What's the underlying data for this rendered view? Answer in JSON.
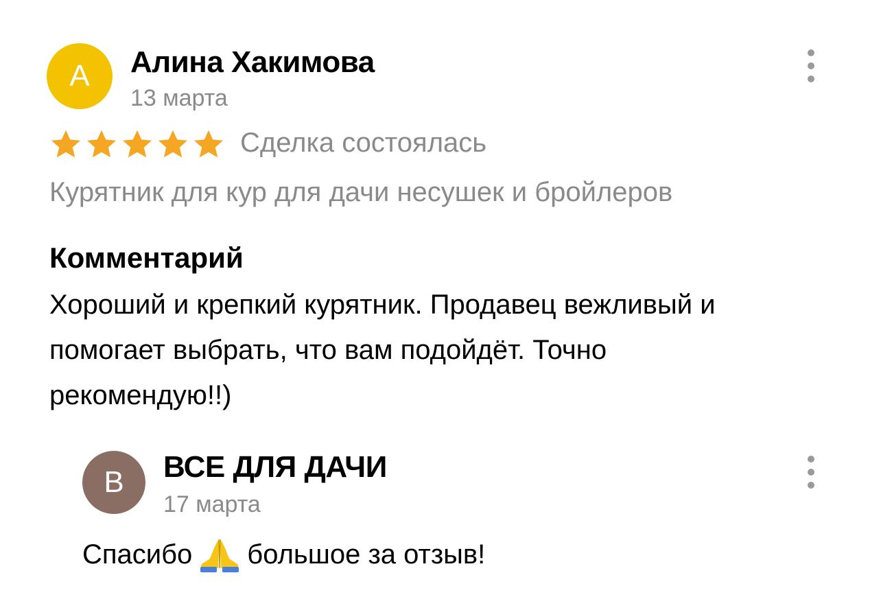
{
  "review": {
    "avatar_letter": "А",
    "avatar_color": "#f3c200",
    "author": "Алина Хакимова",
    "date": "13 марта",
    "rating": 5,
    "rating_max": 5,
    "star_icon": "star-icon",
    "star_color": "#f5a623",
    "deal_status": "Сделка состоялась",
    "product": "Курятник для кур для дачи несушек и бройлеров",
    "comment_heading": "Комментарий",
    "comment_lines": [
      "Хороший и крепкий курятник. Продавец вежливый и",
      "помогает выбрать, что вам подойдёт. Точно",
      "рекомендую!!)"
    ],
    "more_icon": "more-vertical-icon"
  },
  "reply": {
    "avatar_letter": "В",
    "avatar_color": "#8b6e63",
    "author": "ВСЕ ДЛЯ ДАЧИ",
    "date": "17 марта",
    "text_before_emoji": "Спасибо",
    "emoji_icon": "praying-hands-icon",
    "text_after_emoji": "большое за отзыв!",
    "more_icon": "more-vertical-icon"
  }
}
